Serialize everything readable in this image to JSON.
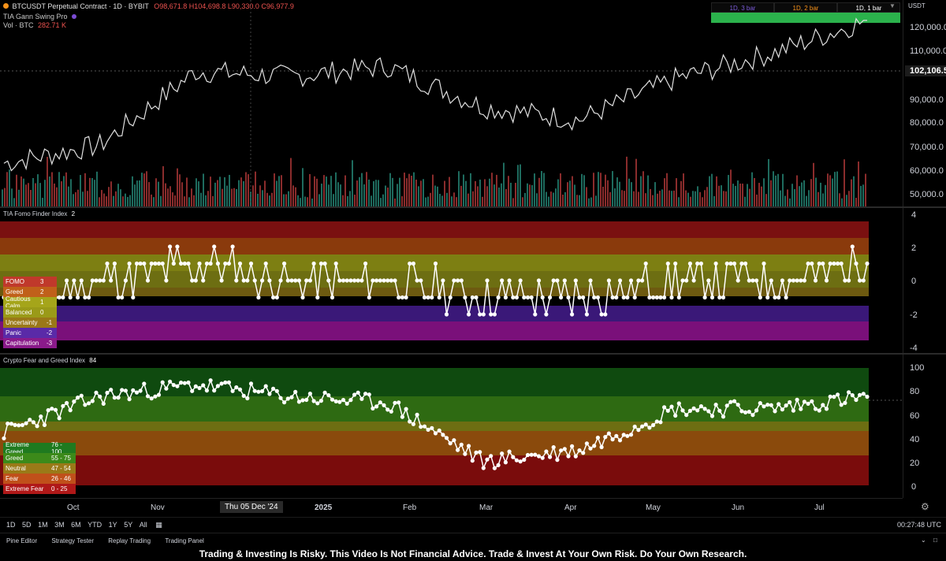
{
  "symbol": {
    "title": "BTCUSDT Perpetual Contract · 1D · BYBIT",
    "ohlc": "O98,671.8 H104,698.8 L90,330.0 C96,977.9",
    "indicator1": "TIA Gann Swing Pro",
    "volume_label": "Vol · BTC",
    "volume_value": "282.71 K"
  },
  "timeframe_table": {
    "headers": [
      "1D, 3 bar",
      "1D, 2 bar",
      "1D, 1 bar"
    ]
  },
  "price_axis": {
    "currency": "USDT",
    "ticks": [
      "120,000.0",
      "110,000.0",
      "100,000.0",
      "90,000.0",
      "80,000.0",
      "70,000.0",
      "60,000.0",
      "50,000.0"
    ],
    "current_price": "102,106.5"
  },
  "fomo_panel": {
    "title": "TIA Fomo Finder Index",
    "value": "2",
    "axis_ticks": [
      "4",
      "2",
      "0",
      "-2",
      "-4"
    ],
    "legend": [
      {
        "label": "FOMO",
        "value": "3"
      },
      {
        "label": "Greed",
        "value": "2"
      },
      {
        "label": "Cautious Calm",
        "value": "1"
      },
      {
        "label": "Balanced",
        "value": "0"
      },
      {
        "label": "Uncertainty",
        "value": "-1"
      },
      {
        "label": "Panic",
        "value": "-2"
      },
      {
        "label": "Capitulation",
        "value": "-3"
      }
    ],
    "colors": {
      "fomo": "#7a1010",
      "greed": "#8a3a0c",
      "calm": "#7d7f12",
      "balanced": "#6d6e12",
      "uncertainty": "#7a6a10",
      "panic": "#3a1878",
      "capitulation": "#7a107a"
    }
  },
  "fng_panel": {
    "title": "Crypto Fear and Greed Index",
    "value": "84",
    "axis_ticks": [
      "100",
      "80",
      "60",
      "40",
      "20",
      "0"
    ],
    "legend": [
      {
        "label": "Extreme Greed",
        "range": "76 - 100"
      },
      {
        "label": "Greed",
        "range": "55 - 75"
      },
      {
        "label": "Neutral",
        "range": "47 - 54"
      },
      {
        "label": "Fear",
        "range": "26 - 46"
      },
      {
        "label": "Extreme Fear",
        "range": "0 - 25"
      }
    ]
  },
  "time_axis": {
    "labels": [
      "Oct",
      "Nov",
      "2025",
      "Feb",
      "Mar",
      "Apr",
      "May",
      "Jun",
      "Jul"
    ],
    "crosshair_label": "Thu 05 Dec '24"
  },
  "range_buttons": [
    "1D",
    "5D",
    "1M",
    "3M",
    "6M",
    "YTD",
    "1Y",
    "5Y",
    "All"
  ],
  "clock": "00:27:48 UTC",
  "footer_tabs": [
    "Pine Editor",
    "Strategy Tester",
    "Replay Trading",
    "Trading Panel"
  ],
  "disclaimer": "Trading & Investing Is Risky. This Video Is Not Financial Advice. Trade & Invest At Your Own Risk. Do Your Own Research.",
  "chart_data": [
    {
      "type": "line",
      "title": "BTCUSDT Perpetual Contract · 1D · BYBIT",
      "x": [
        "Oct",
        "Nov",
        "Dec",
        "2025",
        "Feb",
        "Mar",
        "Apr",
        "May",
        "Jun",
        "Jul"
      ],
      "series": [
        {
          "values": [
            62000,
            69000,
            98000,
            96000,
            100000,
            84000,
            79000,
            95000,
            105000,
            118000
          ]
        }
      ],
      "ylim": [
        45000,
        126000
      ]
    },
    {
      "type": "line",
      "title": "TIA Fomo Finder Index",
      "x": [
        "Oct",
        "Nov",
        "Dec",
        "2025",
        "Feb",
        "Mar",
        "Apr",
        "May",
        "Jun",
        "Jul"
      ],
      "series": [
        {
          "values": [
            -1,
            0,
            1,
            0,
            0,
            -1,
            -1,
            0,
            0,
            1
          ]
        }
      ],
      "ylim": [
        -4,
        4
      ]
    },
    {
      "type": "line",
      "title": "Crypto Fear and Greed Index",
      "x": [
        "Oct",
        "Nov",
        "Dec",
        "2025",
        "Feb",
        "Mar",
        "Apr",
        "May",
        "Jun",
        "Jul"
      ],
      "series": [
        {
          "values": [
            45,
            75,
            85,
            75,
            70,
            20,
            30,
            65,
            65,
            75
          ]
        }
      ],
      "ylim": [
        0,
        100
      ]
    }
  ]
}
